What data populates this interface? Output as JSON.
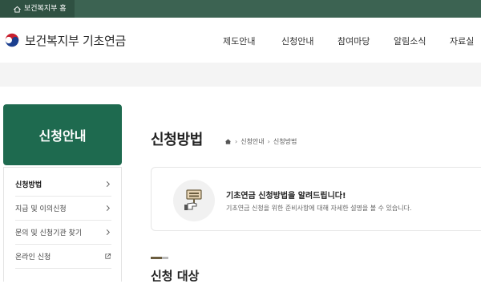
{
  "topbar": {
    "home_label": "보건복지부 홈",
    "home_icon": "house-icon"
  },
  "header": {
    "logo_text": "보건복지부 기초연금",
    "gnb": [
      {
        "label": "제도안내"
      },
      {
        "label": "신청안내"
      },
      {
        "label": "참여마당"
      },
      {
        "label": "알림소식"
      },
      {
        "label": "자료실"
      }
    ]
  },
  "sidebar": {
    "title": "신청안내",
    "items": [
      {
        "label": "신청방법",
        "icon": "chevron-right-icon",
        "active": true
      },
      {
        "label": "지급 및 이의신청",
        "icon": "chevron-right-icon"
      },
      {
        "label": "문의 및 신청기관 찾기",
        "icon": "chevron-right-icon"
      },
      {
        "label": "온라인 신청",
        "icon": "external-link-icon"
      }
    ]
  },
  "main": {
    "page_title": "신청방법",
    "breadcrumb": [
      "신청안내",
      "신청방법"
    ],
    "info": {
      "heading": "기초연금 신청방법을 알려드립니다!",
      "description": "기초연금 신청을 위한 준비사항에 대해 자세한 설명을 볼 수 있습니다.",
      "icon": "sign-holding-hand-icon"
    },
    "section_title": "신청 대상"
  },
  "colors": {
    "topbar": "#3c6352",
    "sidebar_title_bg": "#1e6a4f",
    "accent_bar": "#6b5d3f"
  }
}
